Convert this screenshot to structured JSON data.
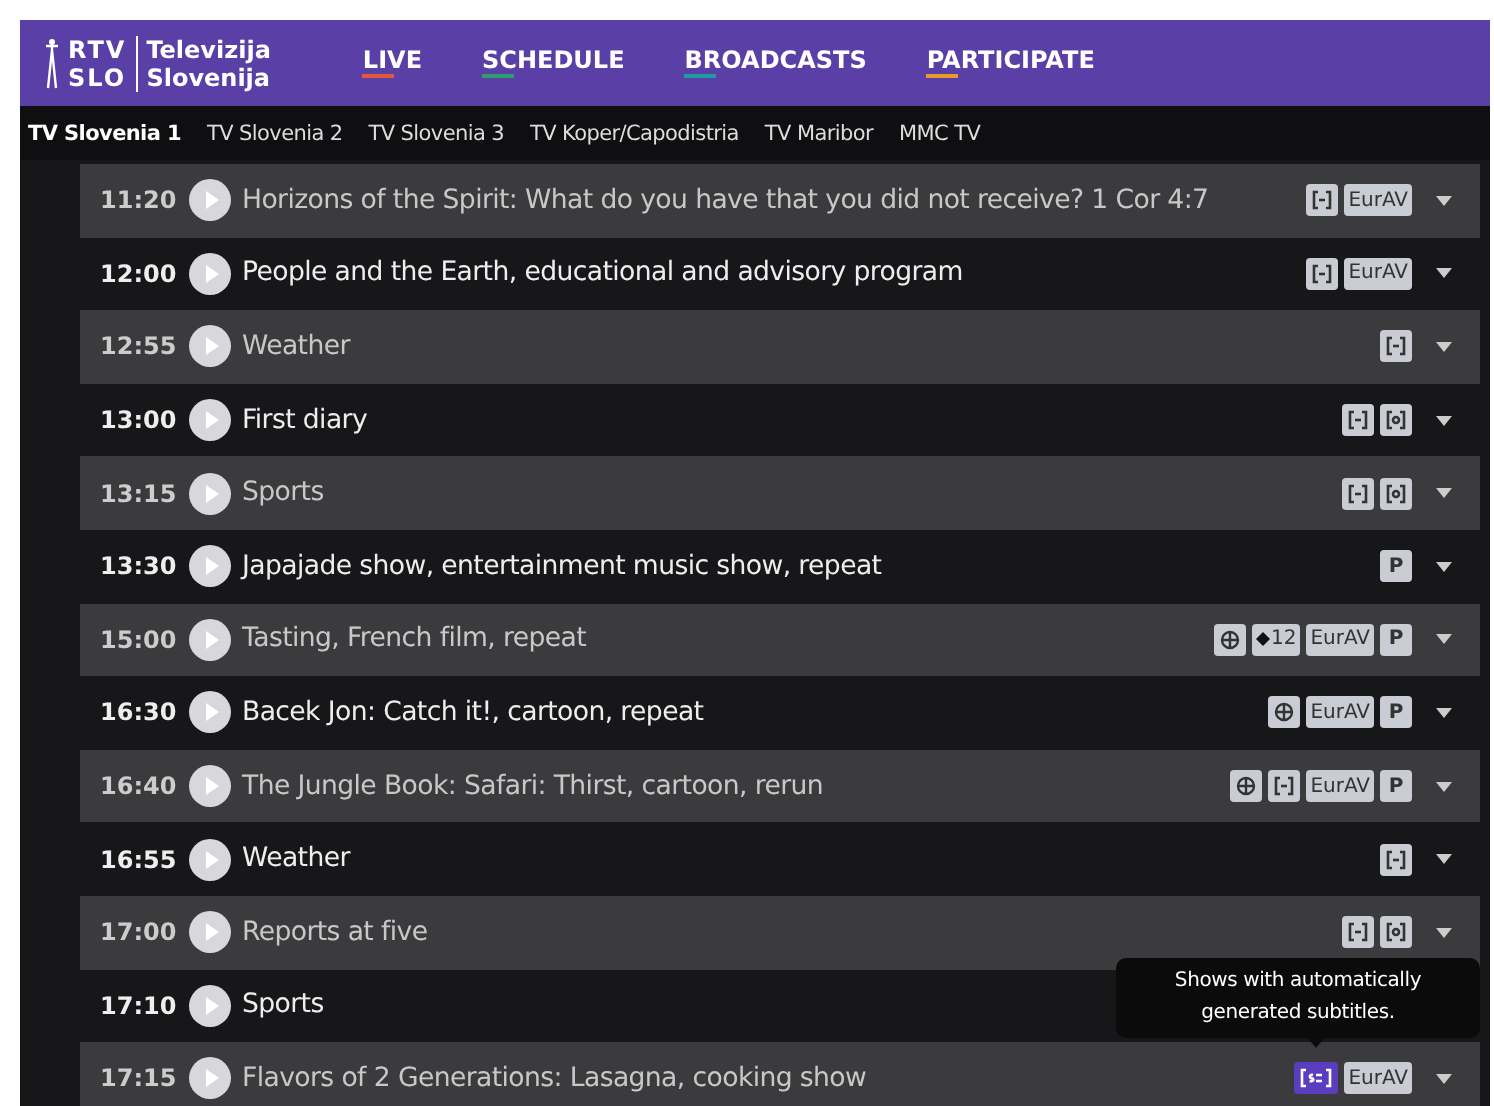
{
  "logo": {
    "line1": "RTV",
    "line2": "SLO",
    "name1": "Televizija",
    "name2": "Slovenija"
  },
  "nav": [
    {
      "label": "LIVE",
      "color": "#e0583a"
    },
    {
      "label": "SCHEDULE",
      "color": "#2e9e6a"
    },
    {
      "label": "BROADCASTS",
      "color": "#1f9aa0"
    },
    {
      "label": "PARTICIPATE",
      "color": "#e89a2c"
    }
  ],
  "channels": [
    {
      "label": "TV Slovenia 1",
      "selected": true
    },
    {
      "label": "TV Slovenia 2",
      "selected": false
    },
    {
      "label": "TV Slovenia 3",
      "selected": false
    },
    {
      "label": "TV Koper/Capodistria",
      "selected": false
    },
    {
      "label": "TV Maribor",
      "selected": false
    },
    {
      "label": "MMC TV",
      "selected": false
    }
  ],
  "schedule": [
    {
      "time": "11:20",
      "title": "Horizons of the Spirit: What do you have that you did not receive? 1 Cor 4:7",
      "badges": [
        {
          "kind": "subtitles"
        },
        {
          "kind": "text",
          "label": "EurAV"
        }
      ]
    },
    {
      "time": "12:00",
      "title": "People and the Earth, educational and advisory program",
      "badges": [
        {
          "kind": "subtitles"
        },
        {
          "kind": "text",
          "label": "EurAV"
        }
      ]
    },
    {
      "time": "12:55",
      "title": "Weather",
      "badges": [
        {
          "kind": "subtitles"
        }
      ]
    },
    {
      "time": "13:00",
      "title": "First diary",
      "badges": [
        {
          "kind": "subtitles"
        },
        {
          "kind": "audio"
        }
      ]
    },
    {
      "time": "13:15",
      "title": "Sports",
      "badges": [
        {
          "kind": "subtitles"
        },
        {
          "kind": "audio"
        }
      ]
    },
    {
      "time": "13:30",
      "title": "Japajade show, entertainment music show, repeat",
      "badges": [
        {
          "kind": "text",
          "label": "P"
        }
      ]
    },
    {
      "time": "15:00",
      "title": "Tasting, French film, repeat",
      "badges": [
        {
          "kind": "globe"
        },
        {
          "kind": "age",
          "label": "12"
        },
        {
          "kind": "text",
          "label": "EurAV"
        },
        {
          "kind": "text",
          "label": "P"
        }
      ]
    },
    {
      "time": "16:30",
      "title": "Bacek Jon: Catch it!, cartoon, repeat",
      "badges": [
        {
          "kind": "globe"
        },
        {
          "kind": "text",
          "label": "EurAV"
        },
        {
          "kind": "text",
          "label": "P"
        }
      ]
    },
    {
      "time": "16:40",
      "title": "The Jungle Book: Safari: Thirst, cartoon, rerun",
      "badges": [
        {
          "kind": "globe"
        },
        {
          "kind": "subtitles"
        },
        {
          "kind": "text",
          "label": "EurAV"
        },
        {
          "kind": "text",
          "label": "P"
        }
      ]
    },
    {
      "time": "16:55",
      "title": "Weather",
      "badges": [
        {
          "kind": "subtitles"
        }
      ]
    },
    {
      "time": "17:00",
      "title": "Reports at five",
      "badges": [
        {
          "kind": "subtitles"
        },
        {
          "kind": "audio"
        }
      ]
    },
    {
      "time": "17:10",
      "title": "Sports"
    },
    {
      "time": "17:15",
      "title": "Flavors of 2 Generations: Lasagna, cooking show",
      "badges": [
        {
          "kind": "auto-subtitles"
        },
        {
          "kind": "text",
          "label": "EurAV"
        }
      ]
    }
  ],
  "tooltip": {
    "text": "Shows with automatically generated subtitles."
  }
}
